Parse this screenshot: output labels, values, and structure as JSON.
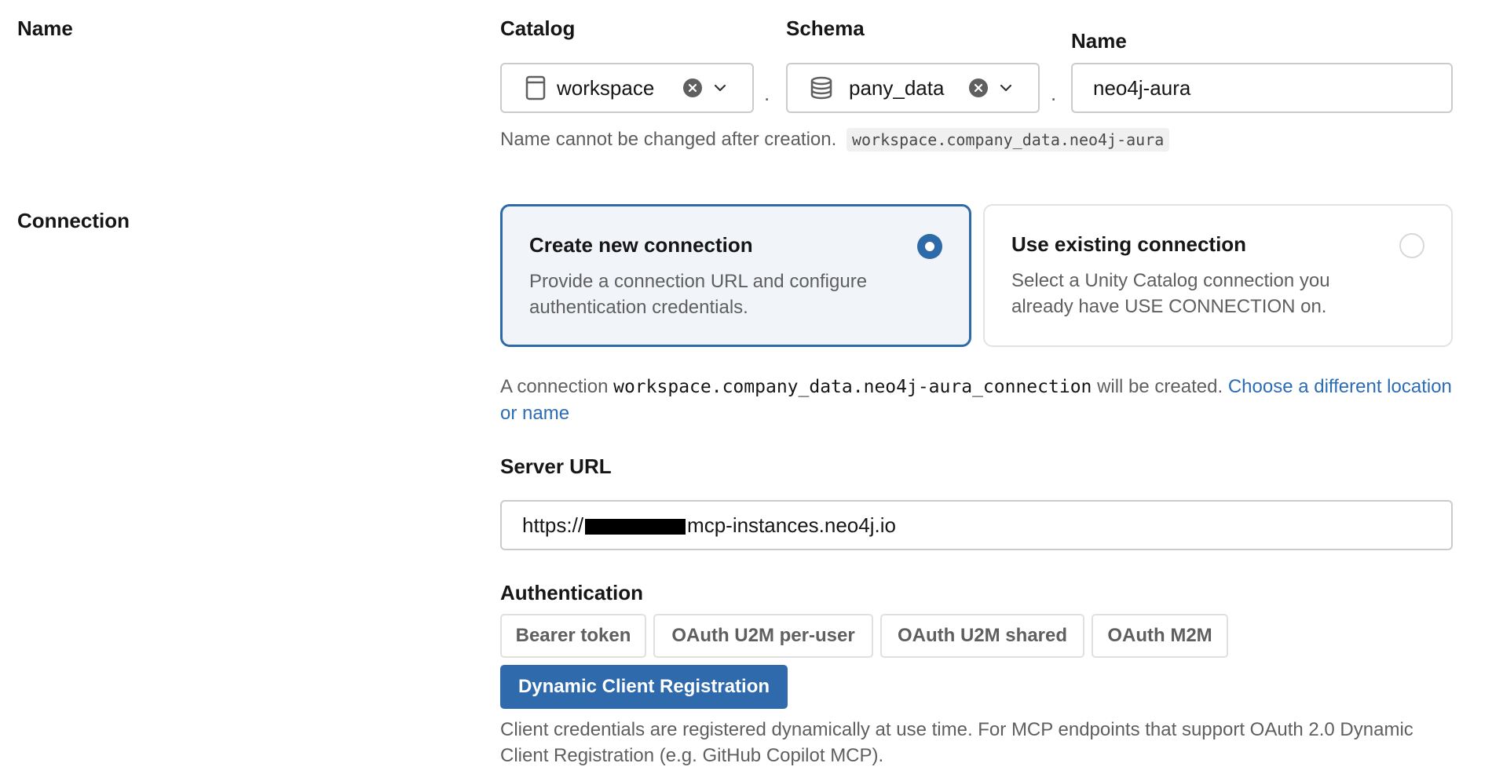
{
  "name_section": {
    "label": "Name",
    "catalog": {
      "label": "Catalog",
      "value": "workspace"
    },
    "schema": {
      "label": "Schema",
      "value": "pany_data"
    },
    "name": {
      "label": "Name",
      "value": "neo4j-aura"
    },
    "separator": ".",
    "help_text": "Name cannot be changed after creation.",
    "full_name": "workspace.company_data.neo4j-aura"
  },
  "connection_section": {
    "label": "Connection",
    "options": [
      {
        "title": "Create new connection",
        "description": "Provide a connection URL and configure authentication credentials.",
        "selected": true
      },
      {
        "title": "Use existing connection",
        "description": "Select a Unity Catalog connection you already have USE CONNECTION on.",
        "selected": false
      }
    ],
    "notice_prefix": "A connection",
    "notice_code": "workspace.company_data.neo4j-aura_connection",
    "notice_suffix": "will be created.",
    "notice_link": "Choose a different location or name",
    "server_url": {
      "label": "Server URL",
      "value_prefix": "https://",
      "value_suffix": "mcp-instances.neo4j.io"
    },
    "authentication": {
      "label": "Authentication",
      "options": [
        "Bearer token",
        "OAuth U2M per-user",
        "OAuth U2M shared",
        "OAuth M2M",
        "Dynamic Client Registration"
      ],
      "selected": "Dynamic Client Registration",
      "help_text": "Client credentials are registered dynamically at use time. For MCP endpoints that support OAuth 2.0 Dynamic Client Registration (e.g. GitHub Copilot MCP)."
    }
  },
  "colors": {
    "accent": "#2f6aad",
    "link": "#2c6cb5",
    "text": "#161616",
    "muted": "#5f5f5f",
    "border": "#cbcbcb"
  },
  "icons": {
    "catalog": "catalog-icon",
    "schema": "database-icon",
    "clear": "clear-icon",
    "chevron": "chevron-down-icon"
  }
}
